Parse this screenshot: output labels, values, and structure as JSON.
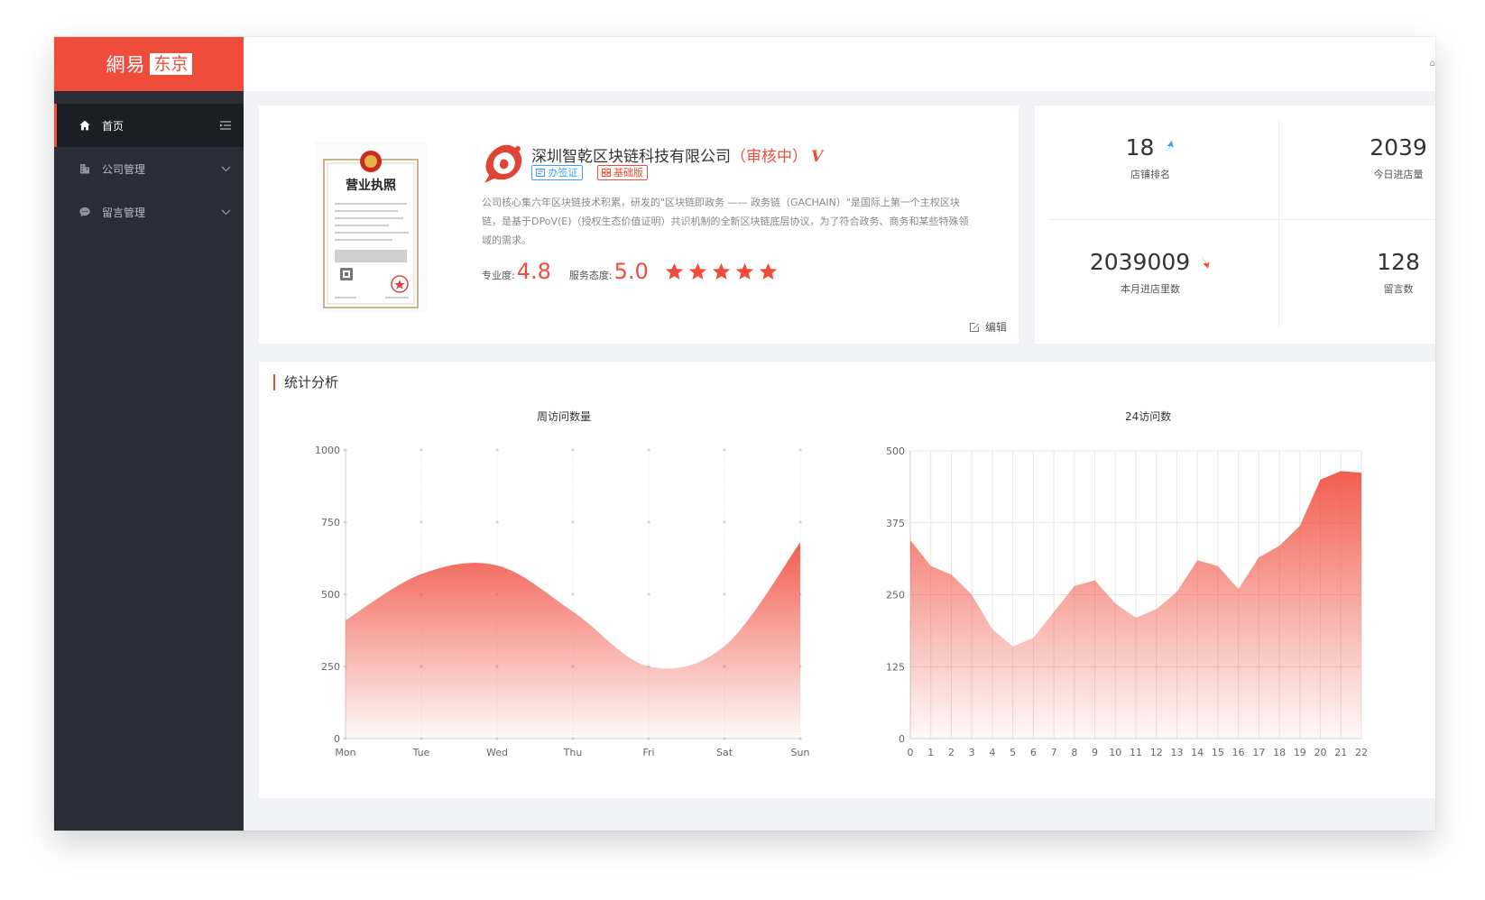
{
  "app": {
    "logo_part1": "網易",
    "logo_part2": "东京"
  },
  "sidebar": {
    "items": [
      {
        "label": "首页",
        "active": true
      },
      {
        "label": "公司管理"
      },
      {
        "label": "留言管理"
      }
    ]
  },
  "header": {
    "edge_glyph": "⌂"
  },
  "company": {
    "name": "深圳智乾区块链科技有限公司",
    "status": "（审核中）",
    "verified_mark": "V",
    "tags": [
      "办签证",
      "基础版"
    ],
    "description": "公司核心集六年区块链技术积累，研发的\"区块链即政务 —— 政务链（GACHAIN）\"是国际上第一个主权区块链，是基于DPoV(E)（授权生态价值证明）共识机制的全新区块链底层协议，为了符合政务、商务和某些特殊领域的需求。",
    "professional_label": "专业度:",
    "professional_score": "4.8",
    "service_label": "服务态度:",
    "service_score": "5.0",
    "stars": 5,
    "edit_label": "编辑",
    "license": {
      "title": "营业执照"
    }
  },
  "stats": [
    {
      "value": "18",
      "label": "店铺排名",
      "trend": "up",
      "color": "#3a9ff5"
    },
    {
      "value": "2039",
      "label": "今日进店量"
    },
    {
      "value": "2039009",
      "label": "本月进店里数",
      "trend": "down",
      "color": "#f04c3c"
    },
    {
      "value": "128",
      "label": "留言数"
    }
  ],
  "analysis": {
    "title": "统计分析"
  },
  "chart_data": [
    {
      "type": "area",
      "title": "周访问数量",
      "categories": [
        "Mon",
        "Tue",
        "Wed",
        "Thu",
        "Fri",
        "Sat",
        "Sun"
      ],
      "values": [
        410,
        570,
        600,
        440,
        250,
        320,
        680
      ],
      "ylim": [
        0,
        1000
      ],
      "yticks": [
        0,
        250,
        500,
        750,
        1000
      ],
      "smooth": true,
      "grid": "vertical",
      "color": "#f04c3c"
    },
    {
      "type": "area",
      "title": "24访问数",
      "categories": [
        "0",
        "1",
        "2",
        "3",
        "4",
        "5",
        "6",
        "7",
        "8",
        "9",
        "10",
        "11",
        "12",
        "13",
        "14",
        "15",
        "16",
        "17",
        "18",
        "19",
        "20",
        "21",
        "22"
      ],
      "values": [
        345,
        300,
        285,
        250,
        190,
        160,
        175,
        220,
        265,
        275,
        235,
        210,
        225,
        255,
        310,
        300,
        260,
        315,
        335,
        370,
        450,
        465,
        462
      ],
      "ylim": [
        0,
        500
      ],
      "yticks": [
        0,
        125,
        250,
        375,
        500
      ],
      "smooth": false,
      "grid": "both",
      "color": "#f04c3c"
    }
  ]
}
